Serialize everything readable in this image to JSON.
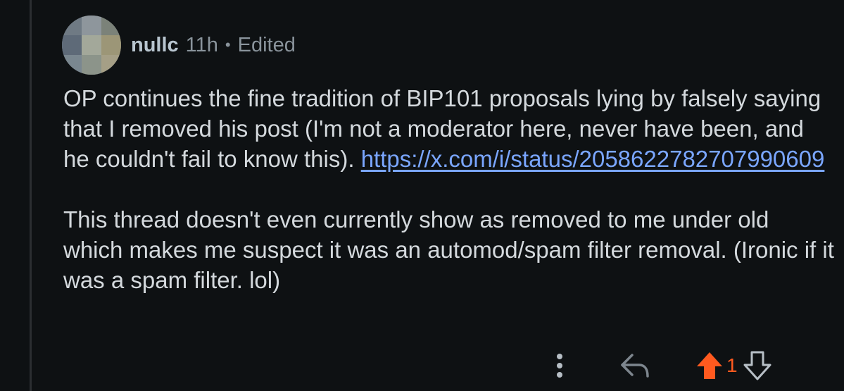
{
  "comment": {
    "author": "nullc",
    "time": "11h",
    "separator": "•",
    "edited": "Edited",
    "paragraph1": {
      "text": "OP continues the fine tradition of BIP101 proposals lying by falsely saying that I removed his post (I'm not a moderator here, never have been, and he couldn't fail to know this).",
      "link": "https://x.com/i/status/2058622782707990609"
    },
    "paragraph2": "This thread doesn't even currently show as removed to me under old which makes me suspect it was an automod/spam filter removal. (Ironic if it was a spam filter. lol)"
  },
  "actions": {
    "more_icon": "more-vertical-icon",
    "reply_icon": "reply-arrow-icon",
    "upvote_icon": "upvote-arrow-icon",
    "downvote_icon": "downvote-arrow-icon",
    "score": "1"
  },
  "colors": {
    "background": "#0e1113",
    "upvoted": "#ff5a1f",
    "link": "#7aa6ff"
  }
}
